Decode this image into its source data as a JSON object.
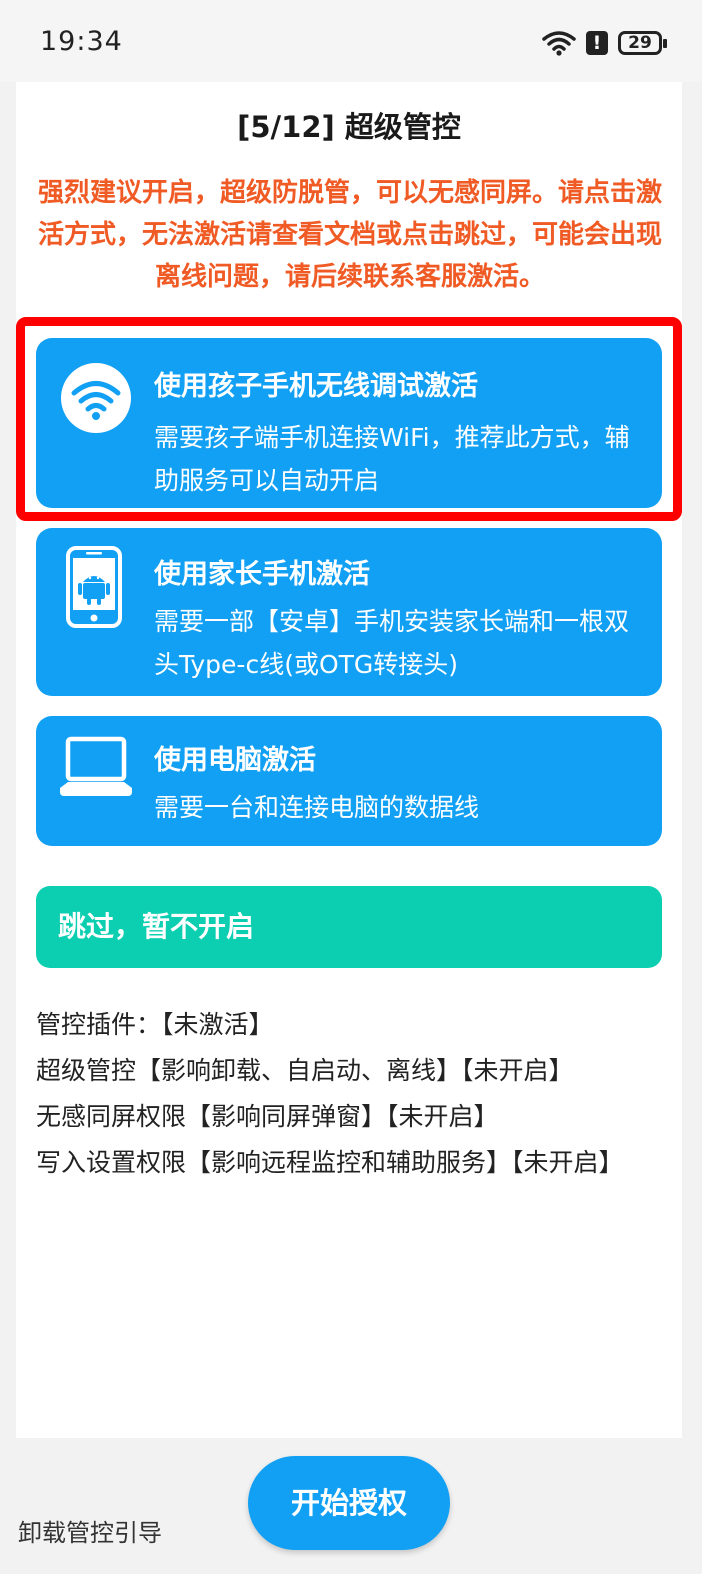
{
  "status_bar": {
    "time": "19:34",
    "battery": "29",
    "alert": "!",
    "icons": [
      "wifi-icon",
      "alert-icon",
      "battery-icon"
    ]
  },
  "page": {
    "title": "[5/12] 超级管控",
    "warning": "强烈建议开启，超级防脱管，可以无感同屏。请点击激活方式，无法激活请查看文档或点击跳过，可能会出现离线问题，请后续联系客服激活。"
  },
  "options": [
    {
      "icon": "wifi-icon",
      "title": "使用孩子手机无线调试激活",
      "desc": "需要孩子端手机连接WiFi，推荐此方式，辅助服务可以自动开启"
    },
    {
      "icon": "android-phone-icon",
      "title": "使用家长手机激活",
      "desc": "需要一部【安卓】手机安装家长端和一根双头Type-c线(或OTG转接头)"
    },
    {
      "icon": "laptop-icon",
      "title": "使用电脑激活",
      "desc": "需要一台和连接电脑的数据线"
    }
  ],
  "skip_label": "跳过，暂不开启",
  "status_lines": [
    "管控插件：【未激活】",
    "超级管控【影响卸载、自启动、离线】【未开启】",
    "无感同屏权限【影响同屏弹窗】【未开启】",
    "写入设置权限【影响远程监控和辅助服务】【未开启】"
  ],
  "bottom": {
    "uninstall_link": "卸载管控引导",
    "start_button": "开始授权"
  },
  "colors": {
    "accent_blue": "#12a0f4",
    "skip_teal": "#0ccfb1",
    "warning_orange": "#f05a24",
    "highlight_red": "#ff0000"
  }
}
